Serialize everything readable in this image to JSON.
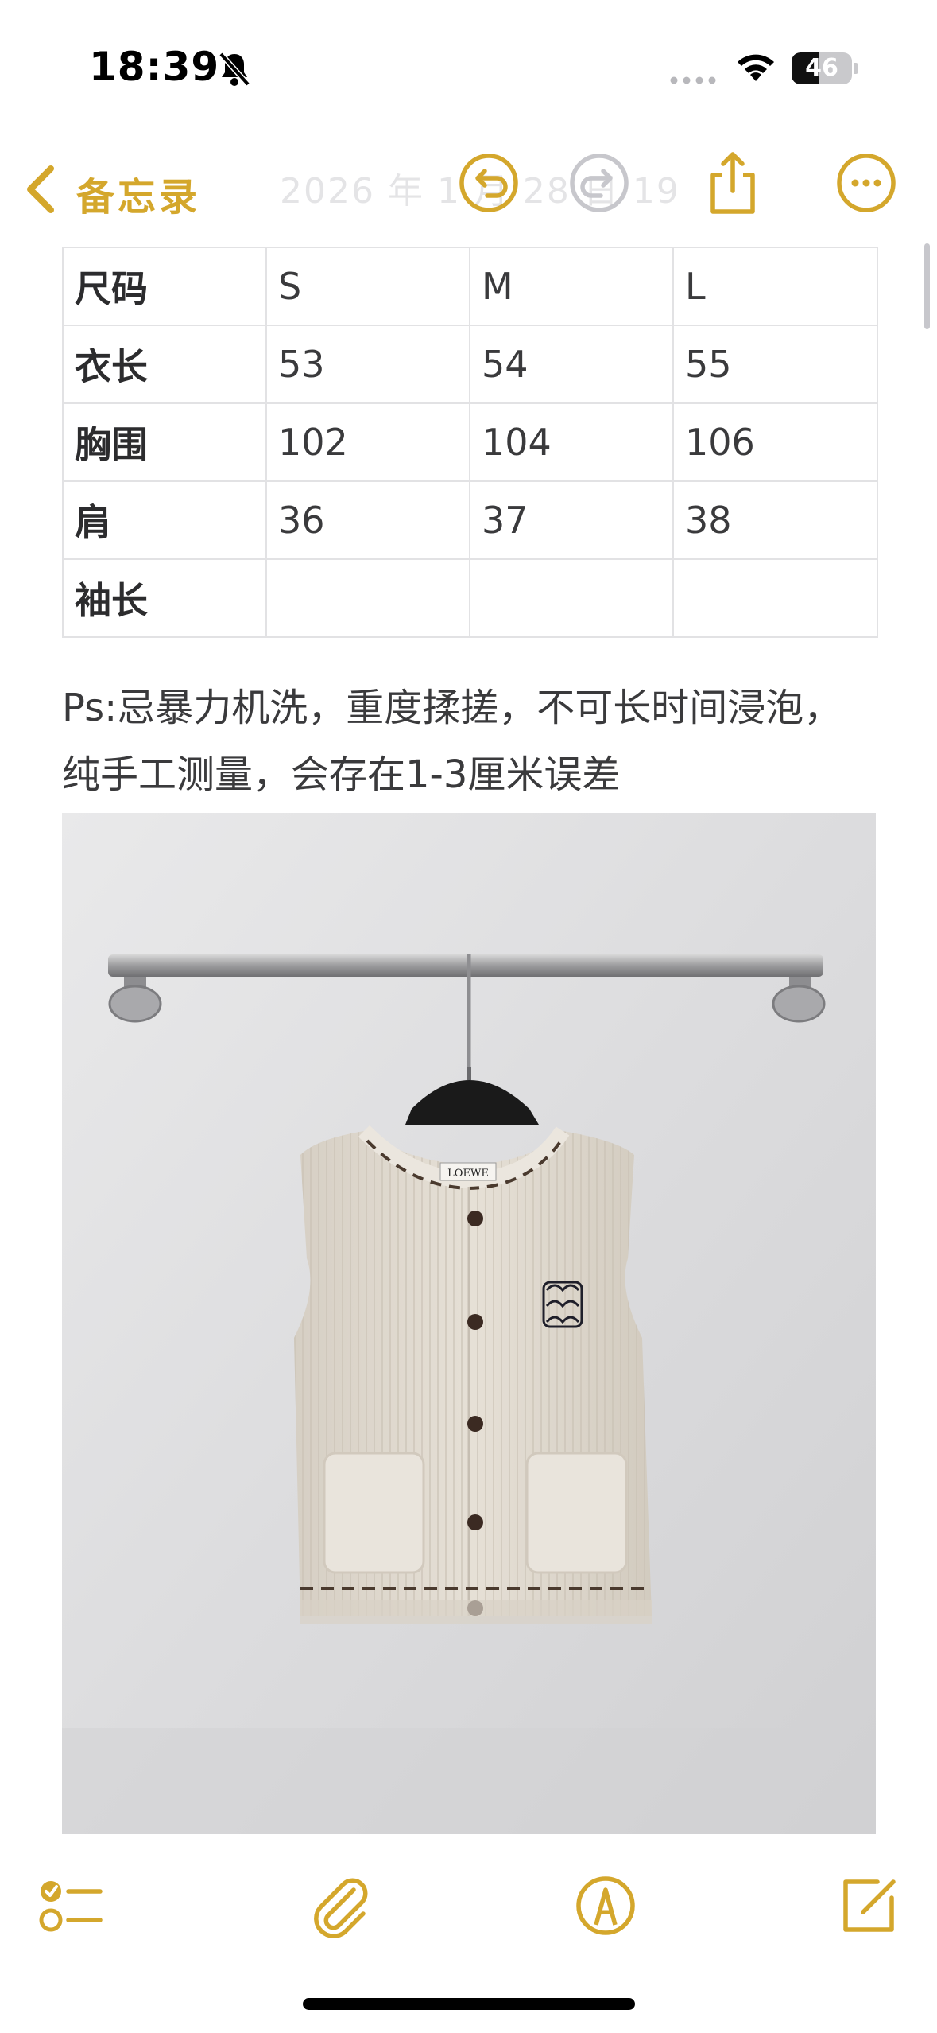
{
  "status_bar": {
    "time": "18:39",
    "battery_level": "46",
    "battery_fraction": 0.46,
    "icons": [
      "bell-slash-icon",
      "cellular-dots-icon",
      "wifi-icon",
      "battery-icon"
    ]
  },
  "nav": {
    "back_label": "备忘录",
    "date": "2026 年 1 月 28 日 19",
    "icons": [
      "chevron-left-icon",
      "undo-icon",
      "redo-icon",
      "share-icon",
      "more-icon"
    ]
  },
  "table": {
    "header": [
      "尺码",
      "S",
      "M",
      "L"
    ],
    "rows": [
      [
        "衣长",
        "53",
        "54",
        "55"
      ],
      [
        "胸围",
        "102",
        "104",
        "106"
      ],
      [
        "肩",
        "36",
        "37",
        "38"
      ],
      [
        "袖长",
        "",
        "",
        ""
      ]
    ]
  },
  "note_text": {
    "line1": "Ps:忌暴力机洗，重度揉搓，不可长时间浸泡，",
    "line2": "纯手工测量，会存在1-3厘米误差"
  },
  "photo": {
    "label_text": "LOEWE",
    "description_icon": "sweater-vest-photo"
  },
  "toolbar": {
    "icons": [
      "checklist-icon",
      "paperclip-icon",
      "markup-pen-icon",
      "compose-icon"
    ]
  },
  "colors": {
    "accent": "#D4A72C",
    "grid": "#E2E2E4",
    "text": "#3A3A3C"
  }
}
